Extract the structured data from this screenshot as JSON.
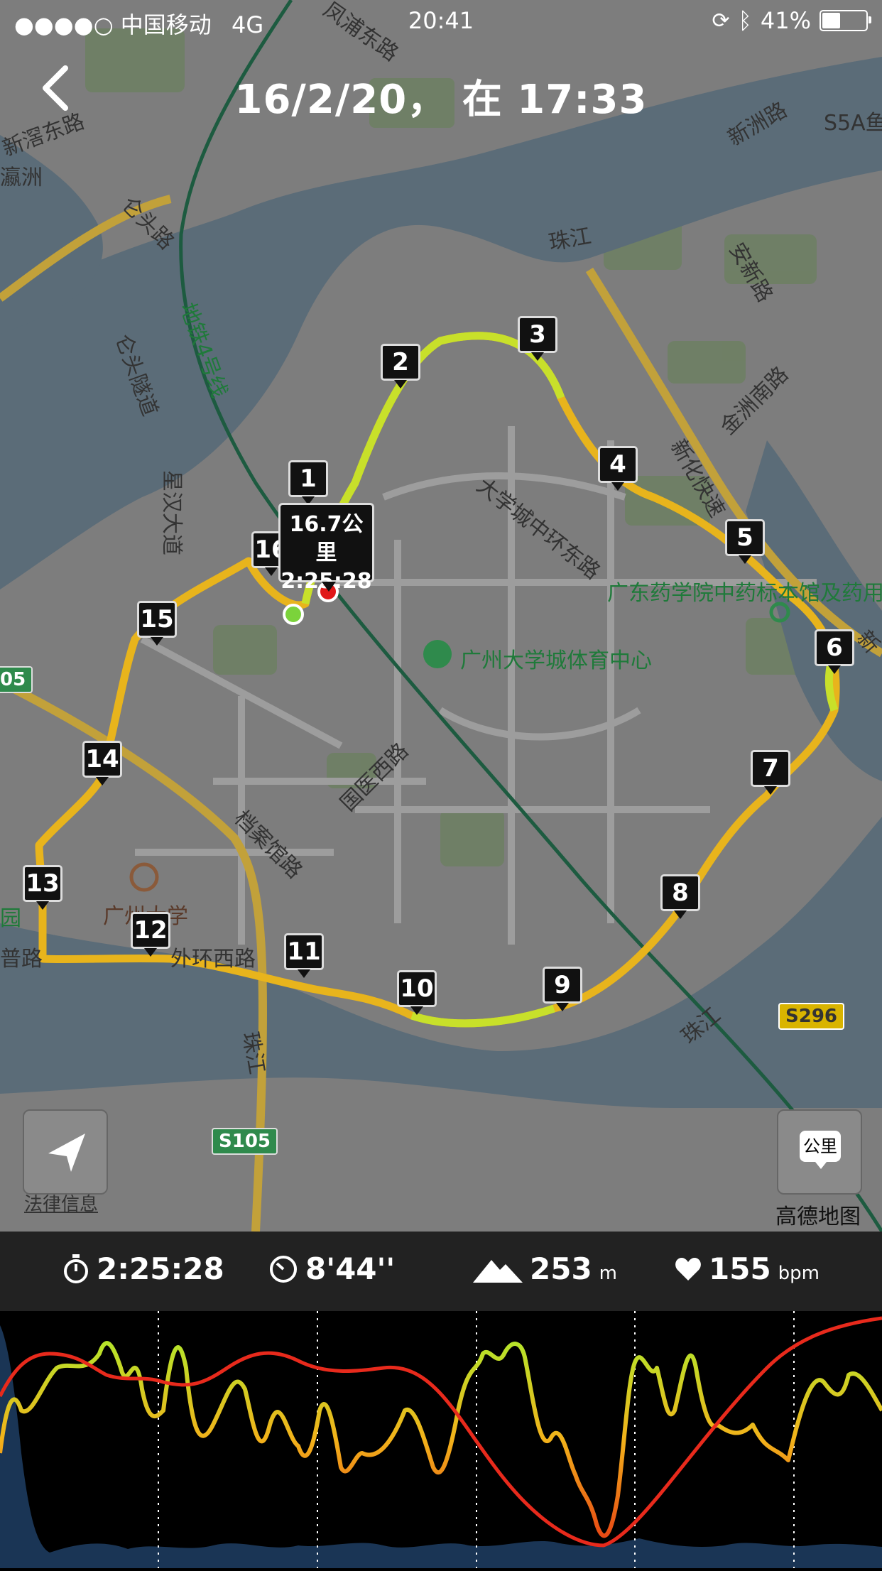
{
  "status_bar": {
    "signal": "●●●●○",
    "carrier": "中国移动",
    "network": "4G",
    "time": "20:41",
    "battery": "41%",
    "battery_level": 0.41
  },
  "header": {
    "title": "16/2/20， 在 17:33"
  },
  "map": {
    "labels": {
      "pearl_river": "珠江",
      "pearl_river_2": "珠江",
      "pearl_river_3": "珠江",
      "metro": "地铁4号线",
      "ring_road": "大学城中环东路",
      "sports_center": "广州大学城体育中心",
      "pharma_museum": "广东药学院中药标本馆及药用",
      "guoyi_road": "国医西路",
      "archives_road": "档案馆路",
      "gz_university": "广州大学",
      "xinhua_express": "新化快速",
      "xingzhou_road": "新洲路",
      "anxin_road": "安新路",
      "jinzhou_road": "金洲南路",
      "xinghan_road": "星汉大道",
      "guantou_road": "仑头路",
      "guantou_tunnel": "仑头隧道",
      "xinjiao_road": "新滘东路",
      "yingzhou_road": "瀛洲",
      "s5a": "S5A鱼",
      "outer_ring": "外环西路",
      "yuan": "园",
      "pu_road": "普路",
      "fengpu_road": "凤浦东路",
      "xin_partial": "新"
    },
    "shields": {
      "s296": "S296",
      "s105": "S105",
      "s05": "05"
    },
    "km_markers": [
      "1",
      "2",
      "3",
      "4",
      "5",
      "6",
      "7",
      "8",
      "9",
      "10",
      "11",
      "12",
      "13",
      "14",
      "15",
      "16"
    ],
    "callout": {
      "distance": "16.7公里",
      "time": "2:25:28"
    },
    "unit_button": "公里",
    "legal": "法律信息",
    "provider": "高德地图"
  },
  "stats": {
    "duration": "2:25:28",
    "pace": "8'44''",
    "elevation": "253",
    "elevation_unit": "m",
    "heart_rate": "155",
    "heart_rate_unit": "bpm"
  }
}
